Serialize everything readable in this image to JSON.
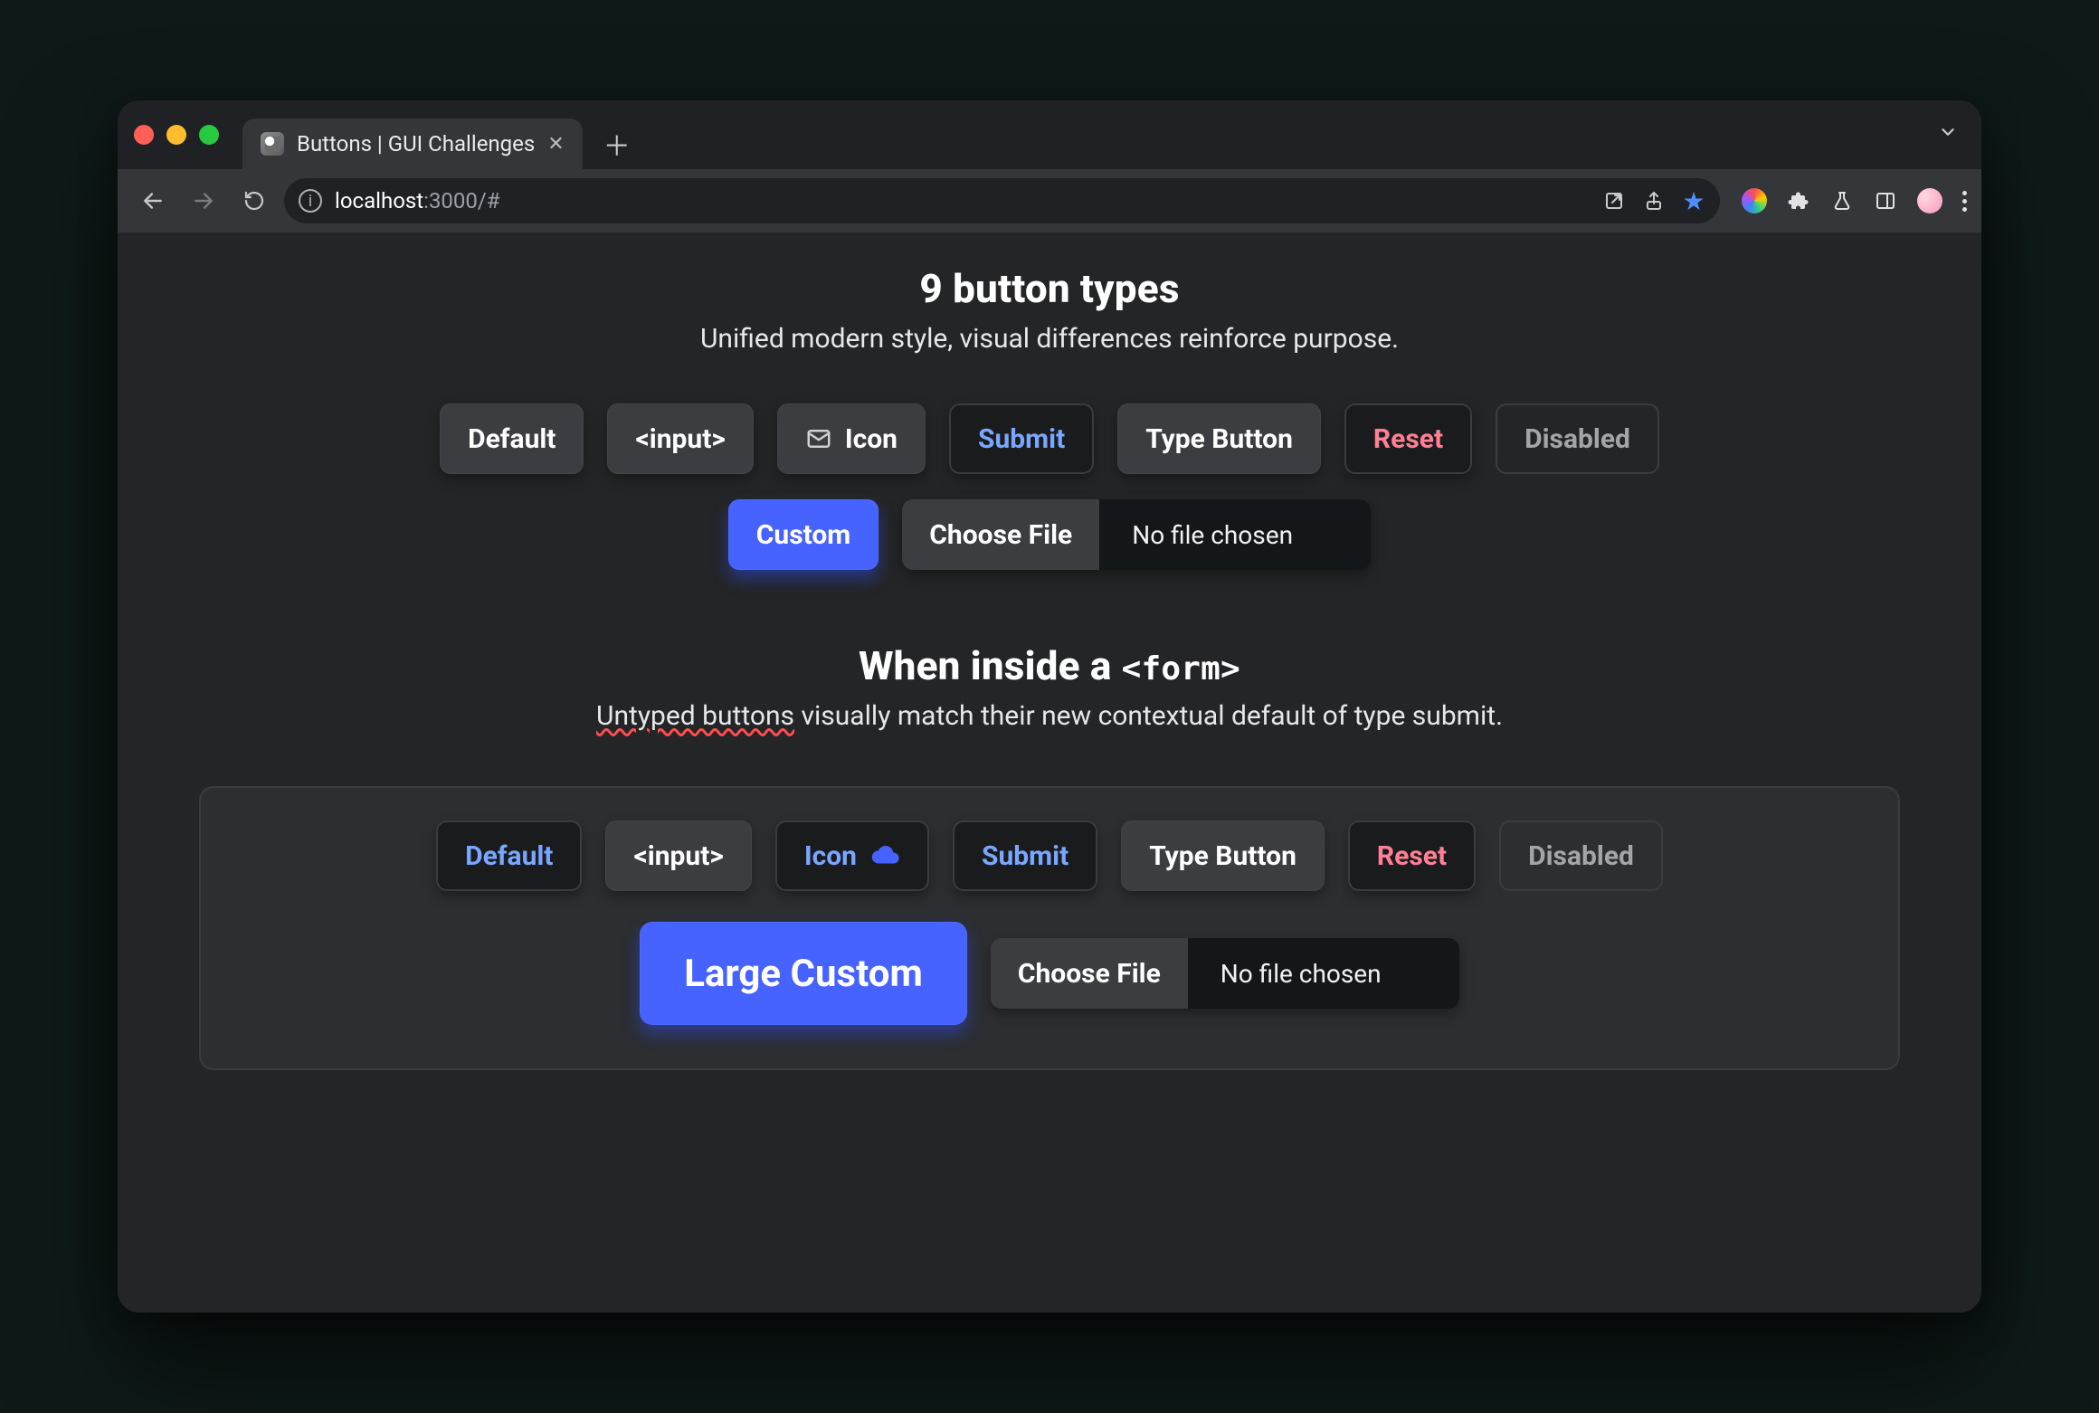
{
  "browser": {
    "tab_title": "Buttons | GUI Challenges",
    "url_host": "localhost",
    "url_port": ":3000",
    "url_path": "/#"
  },
  "section1": {
    "title": "9 button types",
    "subtitle": "Unified modern style, visual differences reinforce purpose.",
    "buttons": {
      "default": "Default",
      "input": "<input>",
      "icon": "Icon",
      "submit": "Submit",
      "type_button": "Type Button",
      "reset": "Reset",
      "disabled": "Disabled",
      "custom": "Custom",
      "choose_file": "Choose File",
      "file_status": "No file chosen"
    }
  },
  "section2": {
    "title_prefix": "When inside a ",
    "title_code": "<form>",
    "subtitle_underlined": "Untyped buttons",
    "subtitle_rest": " visually match their new contextual default of type submit.",
    "buttons": {
      "default": "Default",
      "input": "<input>",
      "icon": "Icon",
      "submit": "Submit",
      "type_button": "Type Button",
      "reset": "Reset",
      "disabled": "Disabled",
      "large_custom": "Large Custom",
      "choose_file": "Choose File",
      "file_status": "No file chosen"
    }
  },
  "colors": {
    "accent": "#4763ff",
    "submit_text": "#79a7ff",
    "reset_text": "#ff7f94"
  }
}
